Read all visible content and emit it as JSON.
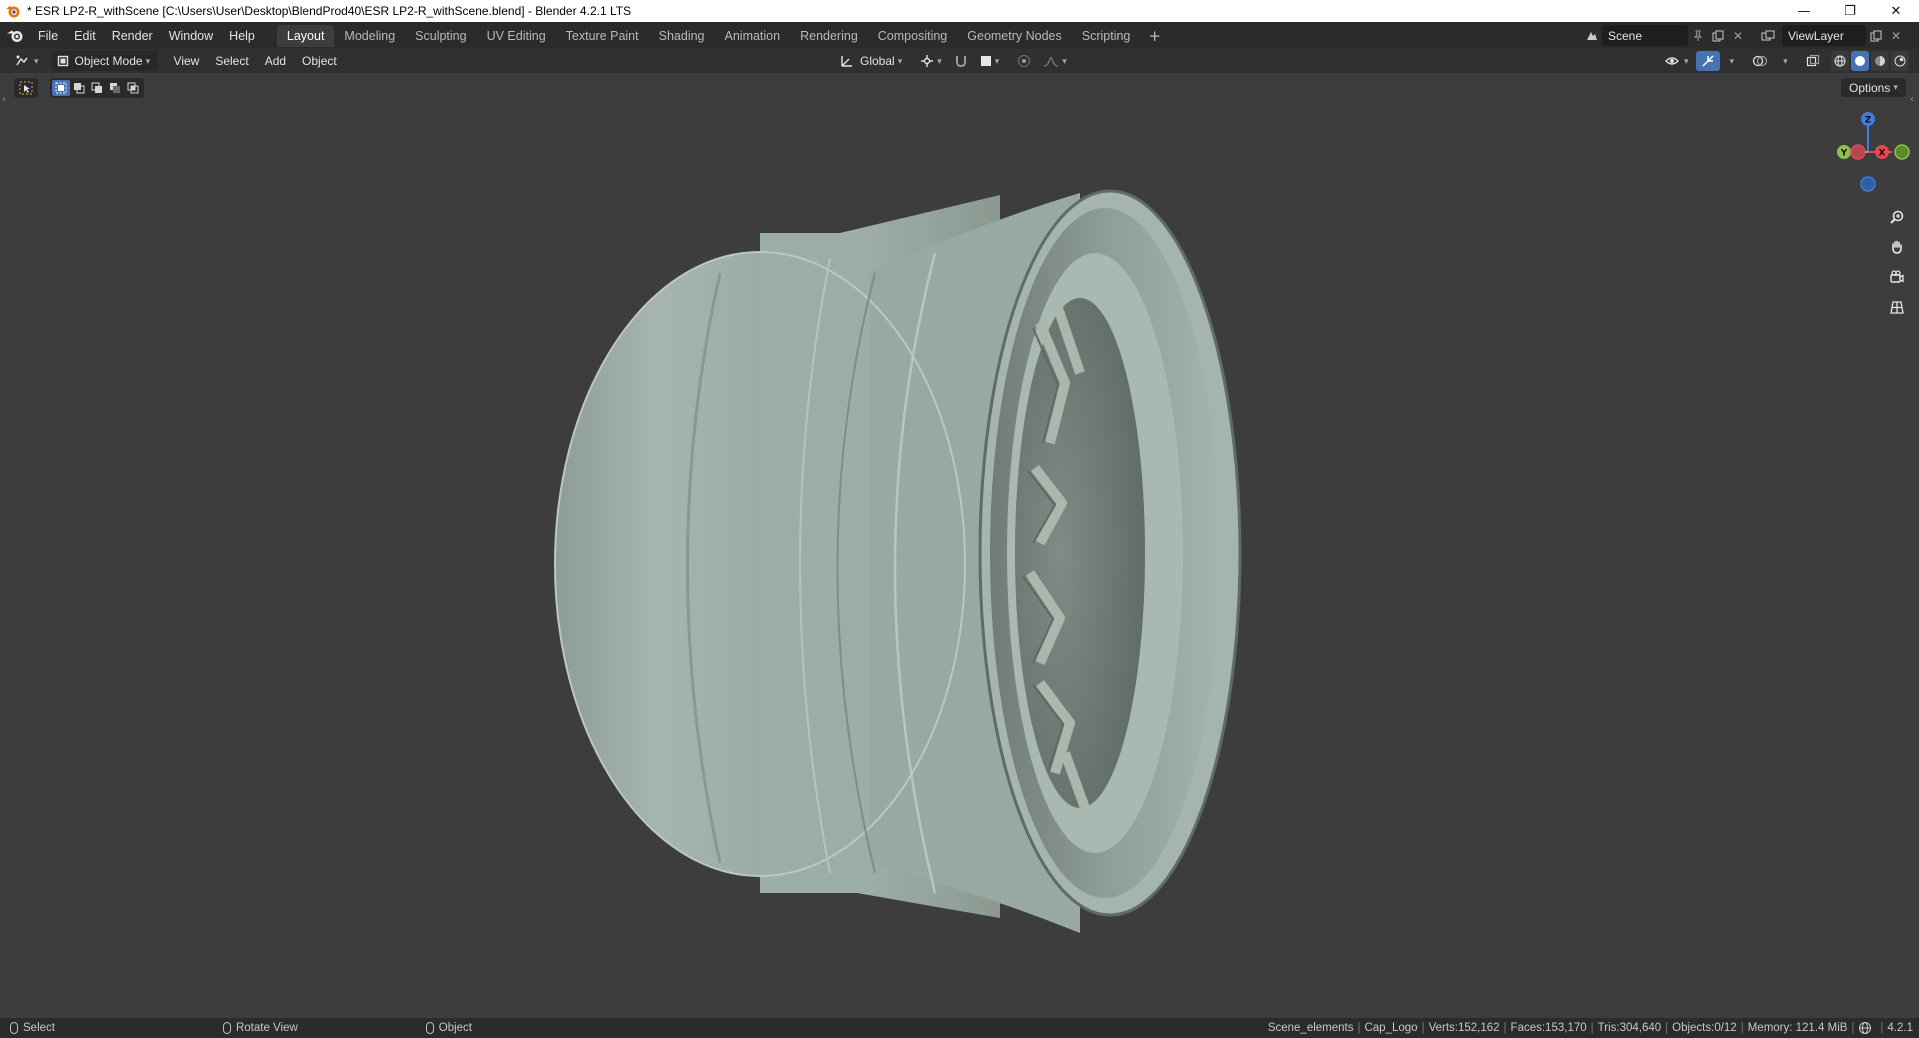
{
  "window": {
    "title": "* ESR LP2-R_withScene [C:\\Users\\User\\Desktop\\BlendProd40\\ESR LP2-R_withScene.blend] - Blender 4.2.1 LTS",
    "minimize": "—",
    "restore": "❐",
    "close": "✕"
  },
  "menubar": {
    "items": [
      "File",
      "Edit",
      "Render",
      "Window",
      "Help"
    ]
  },
  "workspaces": {
    "tabs": [
      "Layout",
      "Modeling",
      "Sculpting",
      "UV Editing",
      "Texture Paint",
      "Shading",
      "Animation",
      "Rendering",
      "Compositing",
      "Geometry Nodes",
      "Scripting"
    ],
    "active": "Layout",
    "add": "+"
  },
  "scene": {
    "name": "Scene",
    "view_layer": "ViewLayer"
  },
  "viewport_header": {
    "mode": "Object Mode",
    "menus": [
      "View",
      "Select",
      "Add",
      "Object"
    ],
    "transform_orientation": "Global"
  },
  "tool_settings": {
    "options_label": "Options"
  },
  "gizmo": {
    "z_label": "Z",
    "y_label": "Y",
    "x_label": "X"
  },
  "statusbar": {
    "select": "Select",
    "rotate_view": "Rotate View",
    "object": "Object",
    "stats": [
      "Scene_elements",
      "Cap_Logo",
      "Verts:152,162",
      "Faces:153,170",
      "Tris:304,640",
      "Objects:0/12",
      "Memory: 121.4 MiB"
    ],
    "version": "4.2.1"
  },
  "colors": {
    "accent": "#4772b3",
    "wheel": "#9fb0a7",
    "background": "#3d3d3d"
  }
}
